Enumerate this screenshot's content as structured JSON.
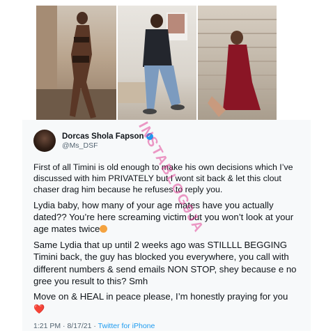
{
  "tweet": {
    "display_name": "Dorcas Shola Fapson",
    "handle": "@Ms_DSF",
    "paragraphs": [
      "First of all Timini is old enough to make his own decisions which I’ve discussed with him PRIVATELY but I wont sit back & let this clout chaser drag him because he refuses to reply you.",
      "Lydia baby, how many of your age mates have you actually dated?? You’re here screaming victim but you won’t look at your age mates twice",
      "Same Lydia that up until 2 weeks ago was STILLLL BEGGING Timini back, the guy has blocked you everywhere, you call with different numbers & send emails NON STOP, shey because e no gree you result to this? Smh",
      "Move on & HEAL in peace please, I’m honestly praying for you"
    ],
    "time": "1:21 PM",
    "separator": "·",
    "date": "8/17/21",
    "source": "Twitter for iPhone",
    "heart_emoji": "❤️"
  },
  "watermark": "INSTABLOG9JA",
  "colors": {
    "accent": "#1d9bf0",
    "text": "#0f1419",
    "secondary": "#536471",
    "card_bg": "#f7f9fa",
    "watermark": "#dc1e82"
  },
  "icons": {
    "verified": "verified-badge-icon",
    "emoji": "blushing-face-icon",
    "heart": "heart-icon"
  }
}
